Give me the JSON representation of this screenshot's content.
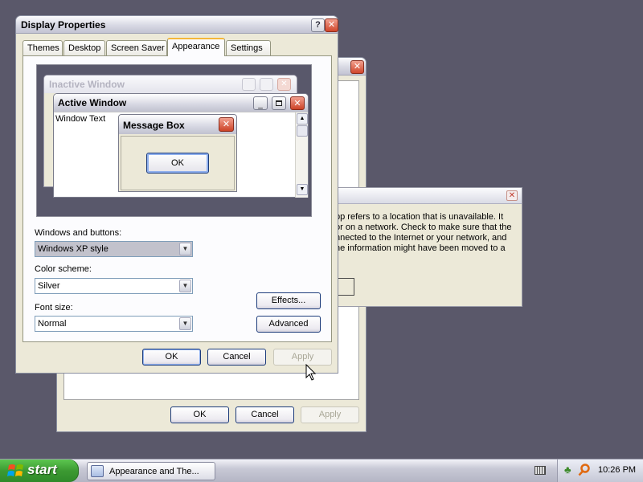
{
  "background_window": {
    "buttons": {
      "ok": "OK",
      "cancel": "Cancel",
      "apply": "Apply"
    }
  },
  "error_dialog": {
    "lines": [
      "pp refers to a location that is unavailable. It",
      "or on a network. Check to make sure that the",
      "nnected to the Internet or your network, and",
      "he information might have been moved to a"
    ]
  },
  "display_properties": {
    "title": "Display Properties",
    "tabs": [
      "Themes",
      "Desktop",
      "Screen Saver",
      "Appearance",
      "Settings"
    ],
    "active_tab": "Appearance",
    "preview": {
      "inactive_window_title": "Inactive Window",
      "active_window_title": "Active Window",
      "window_text": "Window Text",
      "message_box_title": "Message Box",
      "message_box_ok": "OK"
    },
    "windows_buttons": {
      "label": "Windows and buttons:",
      "value": "Windows XP style"
    },
    "color_scheme": {
      "label": "Color scheme:",
      "value": "Silver"
    },
    "font_size": {
      "label": "Font size:",
      "value": "Normal"
    },
    "effects_button": "Effects...",
    "advanced_button": "Advanced",
    "ok_button": "OK",
    "cancel_button": "Cancel",
    "apply_button": "Apply"
  },
  "taskbar": {
    "start_label": "start",
    "task_button_label": "Appearance and The...",
    "clock": "10:26 PM"
  },
  "colors": {
    "desktop": "#5a586a",
    "taskbar": "#c8c9d6",
    "start_button": "#3c9a32",
    "accent_tab": "#f4b73a"
  }
}
